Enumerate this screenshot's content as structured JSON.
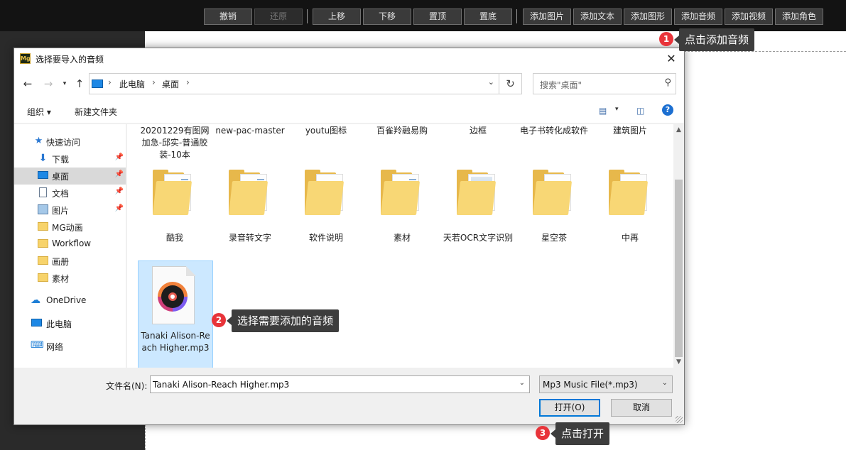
{
  "app": {
    "toolbar_buttons": [
      {
        "label": "撤销",
        "disabled": false
      },
      {
        "label": "还原",
        "disabled": true
      },
      {
        "label": "上移",
        "disabled": false
      },
      {
        "label": "下移",
        "disabled": false
      },
      {
        "label": "置顶",
        "disabled": false
      },
      {
        "label": "置底",
        "disabled": false
      },
      {
        "label": "添加图片",
        "disabled": false
      },
      {
        "label": "添加文本",
        "disabled": false
      },
      {
        "label": "添加图形",
        "disabled": false
      },
      {
        "label": "添加音频",
        "disabled": false
      },
      {
        "label": "添加视频",
        "disabled": false
      },
      {
        "label": "添加角色",
        "disabled": false
      }
    ]
  },
  "callouts": [
    {
      "num": "1",
      "text": "点击添加音频"
    },
    {
      "num": "2",
      "text": "选择需要添加的音频"
    },
    {
      "num": "3",
      "text": "点击打开"
    }
  ],
  "dialog": {
    "app_icon_text": "Mg",
    "title": "选择要导入的音频",
    "close_icon": "✕",
    "address": {
      "segments": [
        "此电脑",
        "桌面"
      ]
    },
    "search_placeholder": "搜索\"桌面\"",
    "toolbar": {
      "organize": "组织 ▾",
      "new_folder": "新建文件夹"
    },
    "help": "?",
    "sidebar": [
      {
        "label": "快速访问",
        "icon": "star-icon",
        "pinned": false
      },
      {
        "label": "下载",
        "icon": "download-icon",
        "pinned": true
      },
      {
        "label": "桌面",
        "icon": "desktop-icon",
        "pinned": true,
        "selected": true
      },
      {
        "label": "文档",
        "icon": "document-icon",
        "pinned": true
      },
      {
        "label": "图片",
        "icon": "picture-icon",
        "pinned": true
      },
      {
        "label": "MG动画",
        "icon": "folder-icon",
        "pinned": false
      },
      {
        "label": "Workflow",
        "icon": "folder-icon",
        "pinned": false
      },
      {
        "label": "画册",
        "icon": "folder-icon",
        "pinned": false
      },
      {
        "label": "素材",
        "icon": "folder-icon",
        "pinned": false
      },
      {
        "label": "OneDrive",
        "icon": "cloud-icon",
        "pinned": false
      },
      {
        "label": "此电脑",
        "icon": "computer-icon",
        "pinned": false
      },
      {
        "label": "网络",
        "icon": "network-icon",
        "pinned": false
      }
    ],
    "top_row": [
      "20201229有图网加急-邱实-普通胶装-10本",
      "new-pac-master",
      "youtu图标",
      "百雀羚融易购",
      "边框",
      "电子书转化成软件",
      "建筑图片"
    ],
    "folders": [
      {
        "name": "酷我",
        "style": "docs"
      },
      {
        "name": "录音转文字",
        "style": "docs"
      },
      {
        "name": "软件说明",
        "style": "mini"
      },
      {
        "name": "素材",
        "style": "docs"
      },
      {
        "name": "天若OCR文字识别",
        "style": "sky"
      },
      {
        "name": "星空茶",
        "style": "pdf"
      },
      {
        "name": "中再",
        "style": "mini-brown"
      }
    ],
    "selected_file": "Tanaki Alison-Reach Higher.mp3",
    "pin_glyph": "📌",
    "bottom": {
      "filename_label": "文件名(N):",
      "filename_value": "Tanaki Alison-Reach Higher.mp3",
      "filetype_value": "Mp3 Music File(*.mp3)",
      "open_label": "打开(O)",
      "cancel_label": "取消"
    }
  }
}
